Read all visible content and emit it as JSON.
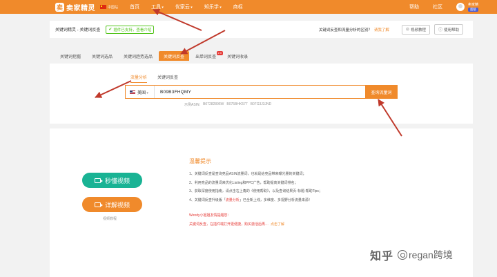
{
  "topbar": {
    "logo_mark": "卖",
    "logo_text": "卖家精灵",
    "site": "中国站",
    "nav": [
      "首页",
      "工具",
      "优家云",
      "知乐学",
      "商标"
    ],
    "nav_caret": [
      false,
      true,
      true,
      true,
      false
    ],
    "right_links": [
      "帮助",
      "社区"
    ],
    "user_name": "卖家精",
    "vip": "超级"
  },
  "header": {
    "breadcrumb": "关键词精灵 - 关键词反查",
    "plugin_badge": "插件已支持，查看介绍",
    "question": "关键词反查和流量分析的区别？",
    "question_link": "请我了解",
    "btn_tutorial": "视频教程",
    "btn_help": "使用帮助"
  },
  "tabs": [
    {
      "label": "关键词挖掘",
      "active": false,
      "badge": ""
    },
    {
      "label": "关键词选品",
      "active": false,
      "badge": ""
    },
    {
      "label": "关键词趋势选品",
      "active": false,
      "badge": ""
    },
    {
      "label": "关键词反查",
      "active": true,
      "badge": ""
    },
    {
      "label": "出单词反查",
      "active": false,
      "badge": "2.0"
    },
    {
      "label": "关键词收录",
      "active": false,
      "badge": ""
    }
  ],
  "search": {
    "subtabs": [
      {
        "label": "流量分析",
        "active": true
      },
      {
        "label": "关键词反查",
        "active": false
      }
    ],
    "market": "美国",
    "query": "B09B3FHQMY",
    "button": "查询流量词",
    "examples_label": "示例ASIN:",
    "examples": [
      "B07282895W",
      "B075BHK577",
      "B07G3J3JND"
    ]
  },
  "tutorial": {
    "btn_quick": "秒懂视频",
    "btn_detail": "详解视频",
    "video_tutorial": "视频教程"
  },
  "tips": {
    "title": "温馨提示",
    "items": [
      "1、关键词反查是查询竞品ASIN流量词，也就是给竞品带来曝光量的关键词；",
      "2、利用竞品的流量词来优化Listing和PPC广告，帮助提高关键词排名；",
      "3、获取深度使用指南，请点击右上角的《使用帮助》，以及查询结果页-标题-帮助Tips；"
    ],
    "item4_prefix": "4、关键词反查升级版「",
    "item4_highlight": "流量分析",
    "item4_suffix": "」已全新上线，多维度、多视野分析流量来源！",
    "greet": "Wendy小姐姐友情提醒您：",
    "notice": "关键词反查，在插件端打开更便捷，购买激活后再…",
    "notice_link": "点击了解"
  },
  "watermark": {
    "platform": "知乎",
    "author": "regan跨境"
  },
  "colors": {
    "brand": "#f08a2b",
    "green": "#19b394",
    "red": "#e53935",
    "annotation": "#c0392b"
  }
}
